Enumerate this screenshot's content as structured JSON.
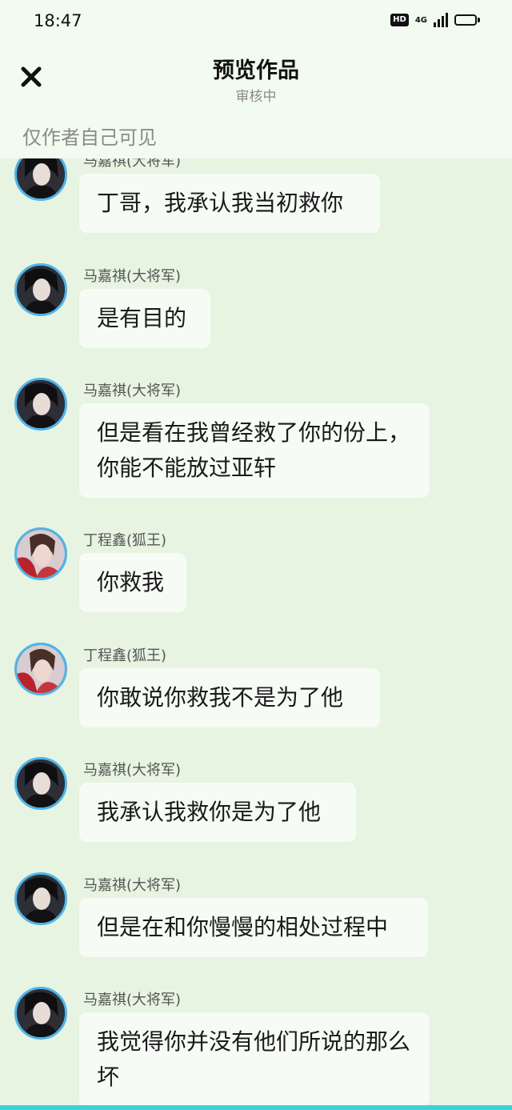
{
  "status_bar": {
    "time": "18:47",
    "hd": "HD",
    "network": "4G"
  },
  "header": {
    "close_icon": "close-icon",
    "title": "预览作品",
    "status": "审核中",
    "visibility": "仅作者自己可见"
  },
  "colors": {
    "background": "#e6f4e1",
    "header_background": "#f2fbef",
    "bubble": "#f7fbf6",
    "avatar_ring": "#4fb4ea"
  },
  "messages": [
    {
      "sender": "马嘉祺(大将军)",
      "text": "丁哥，我承认我当初救你",
      "avatar": "avatar-majiaqi"
    },
    {
      "sender": "马嘉祺(大将军)",
      "text": "是有目的",
      "avatar": "avatar-majiaqi"
    },
    {
      "sender": "马嘉祺(大将军)",
      "text": "但是看在我曾经救了你的份上，你能不能放过亚轩",
      "avatar": "avatar-majiaqi"
    },
    {
      "sender": "丁程鑫(狐王)",
      "text": "你救我",
      "avatar": "avatar-dingchengxin"
    },
    {
      "sender": "丁程鑫(狐王)",
      "text": "你敢说你救我不是为了他",
      "avatar": "avatar-dingchengxin"
    },
    {
      "sender": "马嘉祺(大将军)",
      "text": "我承认我救你是为了他",
      "avatar": "avatar-majiaqi"
    },
    {
      "sender": "马嘉祺(大将军)",
      "text": "但是在和你慢慢的相处过程中",
      "avatar": "avatar-majiaqi"
    },
    {
      "sender": "马嘉祺(大将军)",
      "text": "我觉得你并没有他们所说的那么坏",
      "avatar": "avatar-majiaqi"
    }
  ]
}
